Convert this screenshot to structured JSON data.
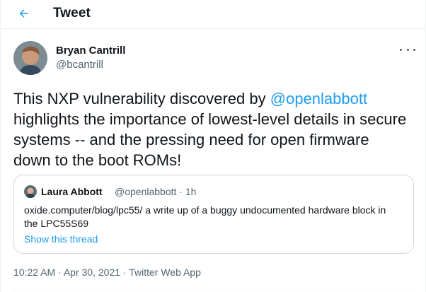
{
  "header": {
    "title": "Tweet",
    "back_icon": "arrow-left-icon",
    "accent": "#1d9bf0"
  },
  "tweet": {
    "author_name": "Bryan Cantrill",
    "author_handle": "@bcantrill",
    "more_icon": "more-dots-icon",
    "text_before": "This NXP vulnerability discovered by ",
    "mention": "@openlabbott",
    "text_after": " highlights the importance of lowest-level details in secure systems -- and the pressing need for open firmware down to the boot ROMs!",
    "time": "10:22 AM",
    "date": "Apr 30, 2021",
    "source": "Twitter Web App",
    "separator": "·"
  },
  "quote": {
    "author_name": "Laura Abbott",
    "author_handle_time": "@openlabbott · 1h",
    "text": "oxide.computer/blog/lpc55/ a write up of a buggy undocumented hardware block in the LPC55S69",
    "show_thread": "Show this thread"
  },
  "colors": {
    "link": "#1d9bf0",
    "secondary_text": "#536471",
    "border": "#cfd9de"
  }
}
